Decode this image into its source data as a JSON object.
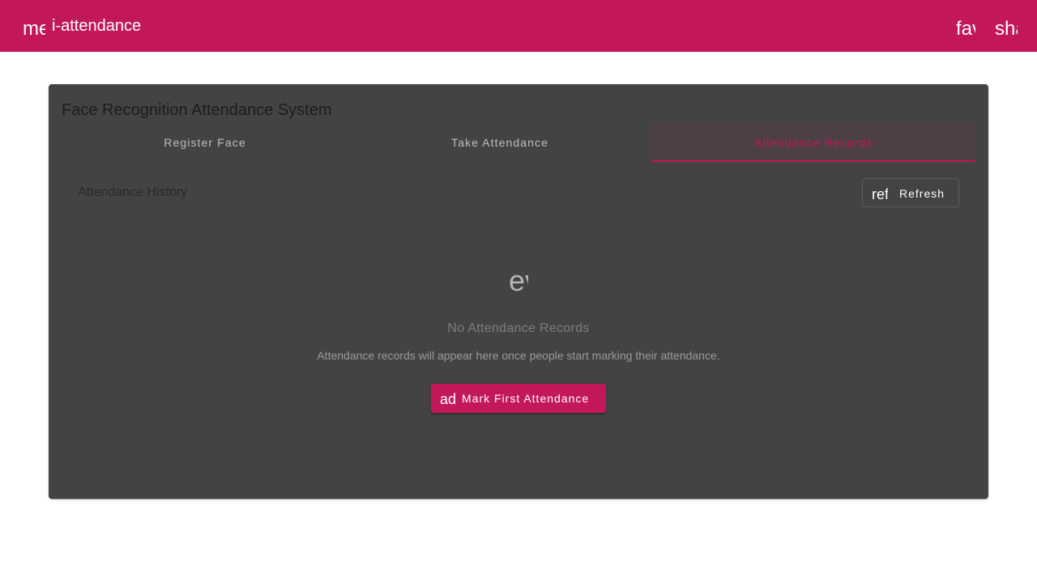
{
  "toolbar": {
    "menu_icon_text": "menu",
    "title": "i-attendance",
    "favorite_icon_text": "favorite",
    "share_icon_text": "share",
    "background_color": "#c2185b"
  },
  "card": {
    "title": "Face Recognition Attendance System",
    "tabs": [
      {
        "label": "Register Face",
        "active": false
      },
      {
        "label": "Take Attendance",
        "active": false
      },
      {
        "label": "Attendance Records",
        "active": true
      }
    ],
    "section_title": "Attendance History",
    "refresh_button": {
      "icon_text": "refresh",
      "label": "Refresh"
    },
    "empty_state": {
      "icon_text": "event_busy",
      "title": "No Attendance Records",
      "description": "Attendance records will appear here once people start marking their attendance.",
      "action_button": {
        "icon_text": "add",
        "label": "Mark First Attendance"
      }
    }
  },
  "colors": {
    "accent": "#c2185b",
    "card_background": "#434343"
  }
}
